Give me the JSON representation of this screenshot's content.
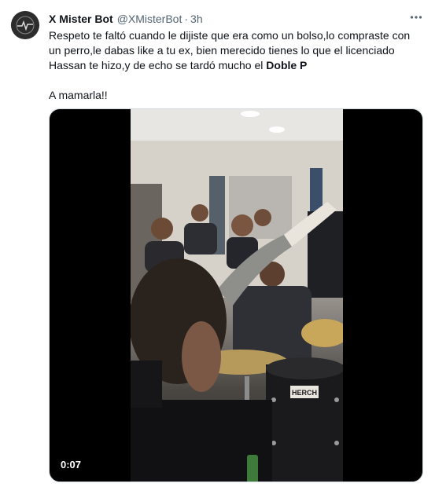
{
  "author": {
    "name": "X Mister Bot",
    "handle": "@XMisterBot",
    "separator": "·",
    "time": "3h"
  },
  "tweet": {
    "text_line_1": "Respeto te faltó cuando le dijiste que era como un bolso,lo compraste con un perro,le dabas like a tu ex, bien merecido tienes lo que el licenciado Hassan te hizo,y de echo se tardó mucho el ",
    "text_bold": "Doble P",
    "text_line_2": "A mamarla!!"
  },
  "media": {
    "duration": "0:07",
    "drum_label": "HERCH"
  },
  "icons": {
    "more": "more-options-icon",
    "avatar": "avatar"
  },
  "colors": {
    "text_primary": "#0f1419",
    "text_secondary": "#536471",
    "media_bg": "#000000"
  }
}
